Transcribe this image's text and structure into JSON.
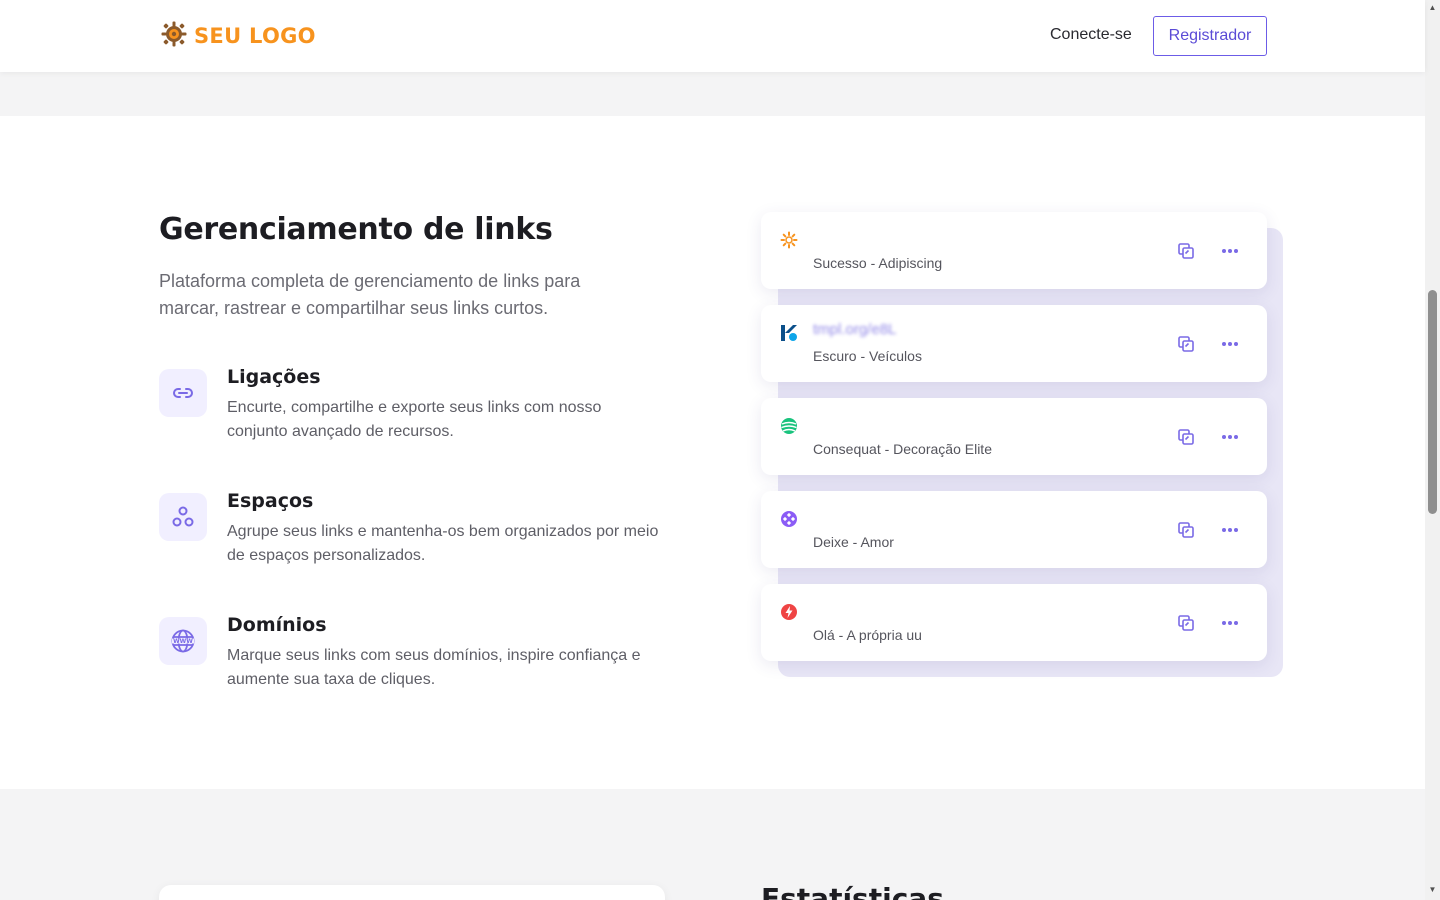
{
  "header": {
    "logo_text": "SEU LOGO",
    "login_label": "Conecte-se",
    "register_label": "Registrador"
  },
  "section": {
    "title": "Gerenciamento de links",
    "subtitle": "Plataforma completa de gerenciamento de links para marcar, rastrear e compartilhar seus links curtos.",
    "features": [
      {
        "title": "Ligações",
        "desc": "Encurte, compartilhe e exporte seus links com nosso conjunto avançado de recursos.",
        "icon": "link-icon"
      },
      {
        "title": "Espaços",
        "desc": "Agrupe seus links e mantenha-os bem organizados por meio de espaços personalizados.",
        "icon": "spaces-icon"
      },
      {
        "title": "Domínios",
        "desc": "Marque seus links com seus domínios, inspire confiança e aumente sua taxa de cliques.",
        "icon": "www-icon"
      }
    ]
  },
  "links": [
    {
      "url": "",
      "label": "Sucesso - Adipiscing",
      "favicon": "sun-icon",
      "color": "#f7931e"
    },
    {
      "url": "tmpl.org/e8L",
      "label": "Escuro - Veículos",
      "favicon": "k-logo-icon",
      "color": "#0078d4"
    },
    {
      "url": "",
      "label": "Consequat - Decoração Elite",
      "favicon": "globe-stripes-icon",
      "color": "#19c37d"
    },
    {
      "url": "",
      "label": "Deixe - Amor",
      "favicon": "diamond-icon",
      "color": "#8b5cf6"
    },
    {
      "url": "",
      "label": "Olá - A própria uu",
      "favicon": "bolt-icon",
      "color": "#ef4444"
    }
  ],
  "lower": {
    "title": "Estatísticas"
  },
  "colors": {
    "accent": "#6c5ce7",
    "brand": "#f7931e",
    "icon_bg": "#f1efff"
  }
}
